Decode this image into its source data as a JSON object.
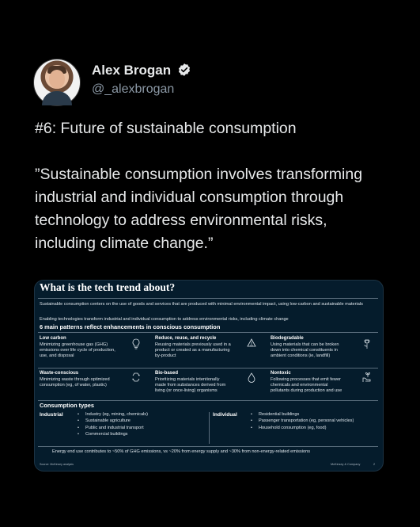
{
  "author": {
    "name": "Alex Brogan",
    "handle": "@_alexbrogan"
  },
  "tweet": {
    "title": "#6: Future of sustainable consumption",
    "quote": "”Sustainable consumption involves transforming industrial and individual consumption through technology to address environmental risks, including climate change.”"
  },
  "card": {
    "title": "What is the tech trend about?",
    "intro": "Sustainable consumption centers on the use of goods and services that are produced with minimal environmental impact, using low-carbon and sustainable materials",
    "enabling": "Enabling technologies transform industrial and individual consumption to address environmental risks, including climate change",
    "patterns_heading": "6 main patterns reflect enhancements in conscious consumption",
    "patterns": [
      {
        "title": "Low carbon",
        "desc": "Minimizing greenhouse gas (GHG) emissions over life cycle of production, use, and disposal",
        "icon": "lightbulb-icon"
      },
      {
        "title": "Reduce, reuse, and recycle",
        "desc": "Reusing materials previously used in a product or created as a manufacturing by-product",
        "icon": "recycle-icon"
      },
      {
        "title": "Biodegradable",
        "desc": "Using materials that can be broken down into chemical constituents in ambient conditions (ie, landfill)",
        "icon": "flower-icon"
      },
      {
        "title": "Waste-conscious",
        "desc": "Minimizing waste through optimized consumption (eg, of water, plastic)",
        "icon": "recycle-arrows-icon"
      },
      {
        "title": "Bio-based",
        "desc": "Prioritizing materials intentionally made from substances derived from living (or once-living) organisms",
        "icon": "drop-icon"
      },
      {
        "title": "Nontoxic",
        "desc": "Following processes that emit fewer chemicals and environmental pollutants during production and use",
        "icon": "hand-plant-icon"
      }
    ],
    "consumption_heading": "Consumption types",
    "industrial": {
      "label": "Industrial",
      "items": [
        "Industry (eg, mining, chemicals)",
        "Sustainable agriculture",
        "Public and industrial transport",
        "Commercial buildings"
      ]
    },
    "individual": {
      "label": "Individual",
      "items": [
        "Residential buildings",
        "Passenger transportation (eg, personal vehicles)",
        "Household consumption (eg, food)"
      ]
    },
    "energy_note": "Energy end use contributes to ~50% of GHG emissions, vs ~20% from energy supply and ~30% from non-energy-related emissions",
    "source": "Source: McKinsey analysis",
    "publisher": "McKinsey & Company",
    "page": "2"
  },
  "colors": {
    "background": "#000000",
    "card": "#051c2c",
    "verified": "#e7e9ea",
    "handle": "#8b98a5"
  }
}
